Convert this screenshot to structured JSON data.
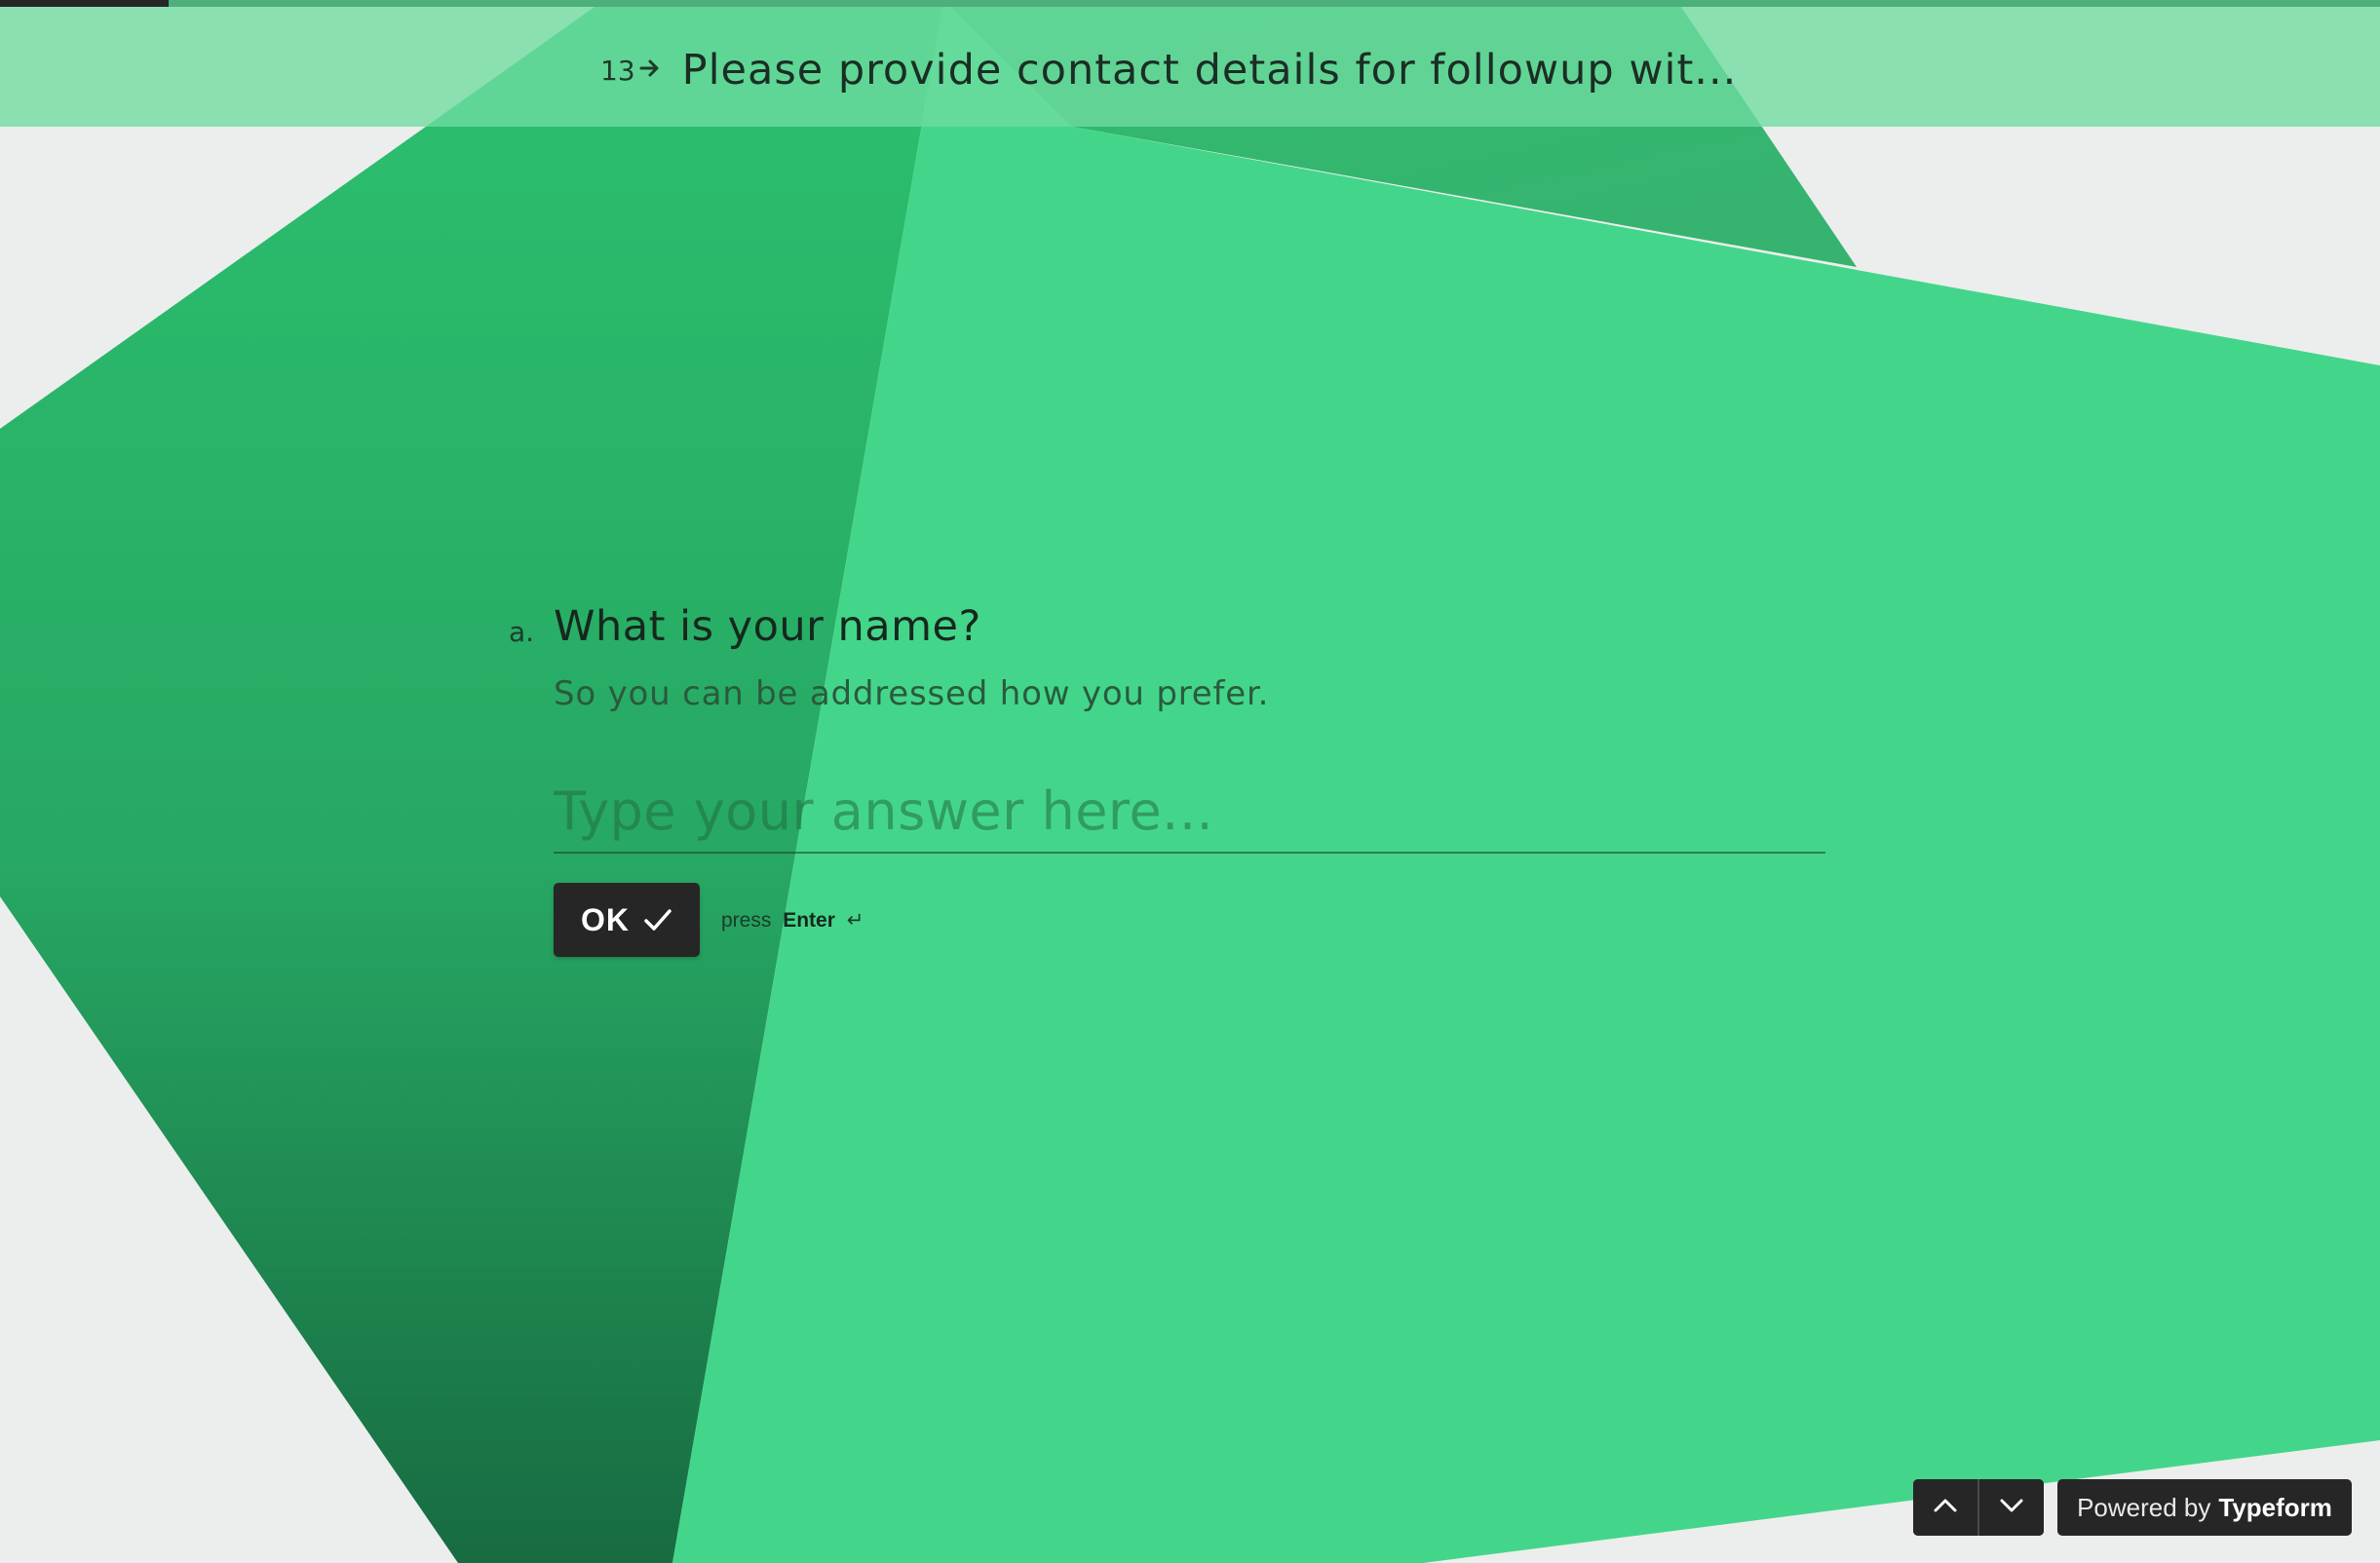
{
  "progress": {
    "fraction": 0.071
  },
  "header": {
    "number": "13",
    "arrow_icon": "arrow-right-icon",
    "title": "Please provide contact details for followup wit..."
  },
  "question": {
    "letter": "a.",
    "title": "What is your name?",
    "description": "So you can be addressed how you prefer.",
    "placeholder": "Type your answer here...",
    "value": ""
  },
  "ok_button": {
    "label": "OK",
    "icon": "check-icon"
  },
  "enter_hint": {
    "prefix": "press",
    "key": "Enter",
    "icon": "enter-icon",
    "symbol": "↵"
  },
  "footer": {
    "prev_icon": "chevron-up-icon",
    "next_icon": "chevron-down-icon",
    "powered_prefix": "Powered by",
    "powered_brand": "Typeform"
  },
  "colors": {
    "background": "#eceeed",
    "shape_light": "#43d68a",
    "shape_dark": "#1e9a58",
    "header_bg": "#6ddc9e",
    "button_bg": "#262626"
  }
}
